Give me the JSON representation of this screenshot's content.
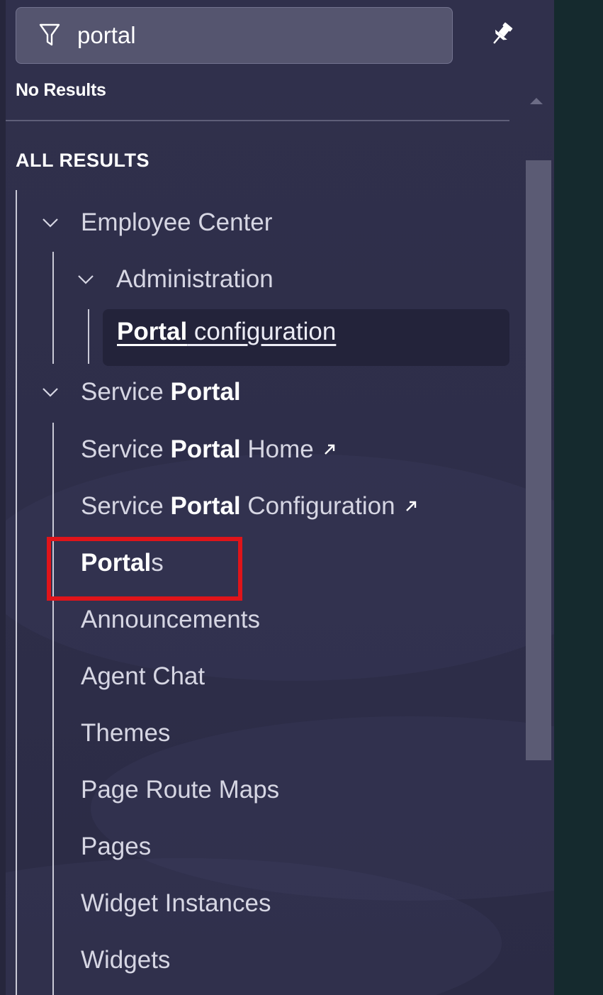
{
  "search": {
    "value": "portal",
    "placeholder": ""
  },
  "no_results": "No Results",
  "section_title": "ALL RESULTS",
  "groups": {
    "employee_center": {
      "label": "Employee Center"
    },
    "administration": {
      "label": "Administration"
    },
    "portal_configuration": {
      "highlight": "Portal",
      "rest": " configuration"
    },
    "service_portal": {
      "prefix": "Service ",
      "highlight": "Portal"
    }
  },
  "items": {
    "sp_home": {
      "prefix": "Service ",
      "highlight": "Portal",
      "suffix": " Home"
    },
    "sp_config": {
      "prefix": "Service ",
      "highlight": "Portal",
      "suffix": " Configuration"
    },
    "portals": {
      "highlight": "Portal",
      "suffix": "s"
    },
    "announcements": "Announcements",
    "agent_chat": "Agent Chat",
    "themes": "Themes",
    "page_route_maps": "Page Route Maps",
    "pages": "Pages",
    "widget_instances": "Widget Instances",
    "widgets": "Widgets"
  },
  "icons": {
    "filter": "filter-icon",
    "pin": "pin-icon",
    "chevron": "chevron-down-icon",
    "external": "external-link-icon"
  },
  "colors": {
    "panel_bg": "#2f2f4a",
    "right_pane": "#152a2e",
    "selected_bg": "#23233a",
    "highlight_red": "#e0141a"
  }
}
